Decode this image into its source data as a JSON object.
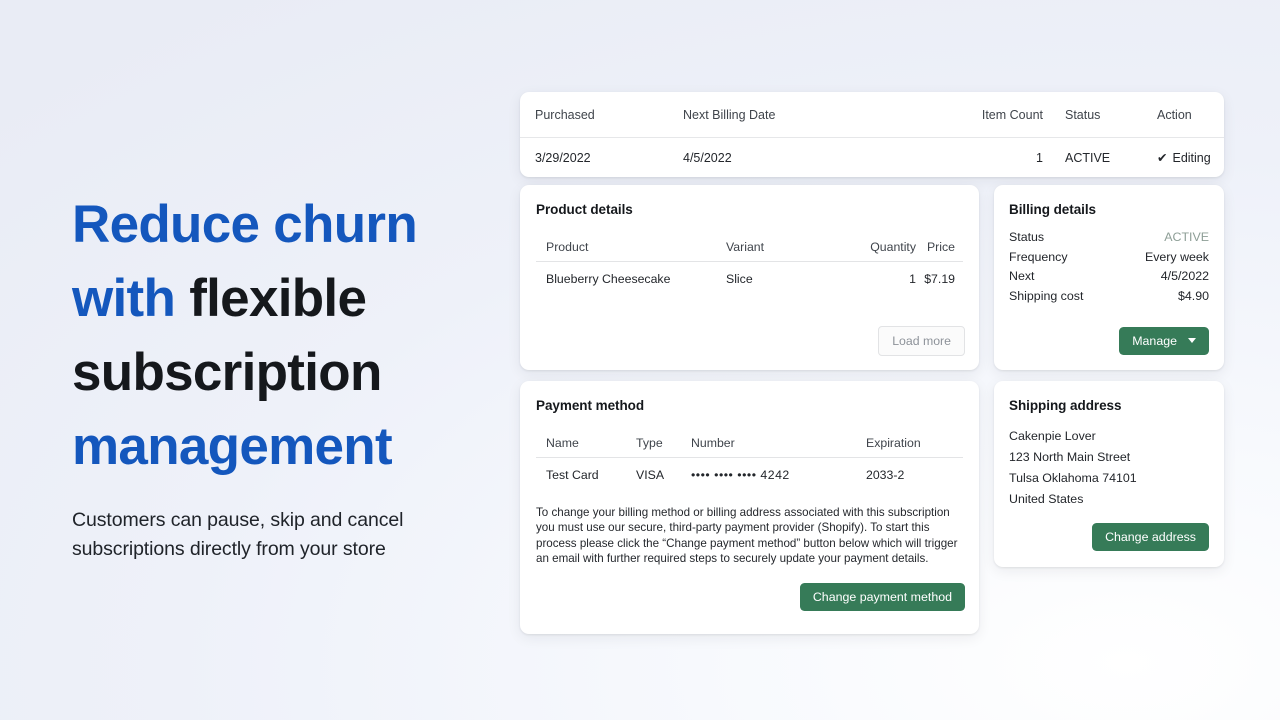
{
  "promo": {
    "headline_part1": "Reduce churn",
    "headline_part2": "with ",
    "headline_part3": "flexible",
    "headline_part4": "subscription",
    "headline_part5": "management",
    "subhead_line1": "Customers can pause, skip and cancel",
    "subhead_line2": "subscriptions directly from your store",
    "accent_blue": "#1457bd",
    "accent_dark": "#15181c"
  },
  "summary": {
    "headers": {
      "purchased": "Purchased",
      "next_billing_date": "Next Billing Date",
      "item_count": "Item Count",
      "status": "Status",
      "action": "Action"
    },
    "row": {
      "purchased": "3/29/2022",
      "next_billing_date": "4/5/2022",
      "item_count": "1",
      "status": "ACTIVE",
      "action": "Editing",
      "action_icon": "check-icon"
    }
  },
  "product_details": {
    "title": "Product details",
    "headers": {
      "product": "Product",
      "variant": "Variant",
      "quantity": "Quantity",
      "price": "Price"
    },
    "rows": [
      {
        "product": "Blueberry Cheesecake",
        "variant": "Slice",
        "quantity": "1",
        "price": "$7.19"
      }
    ],
    "load_more_label": "Load more"
  },
  "billing_details": {
    "title": "Billing details",
    "rows": [
      {
        "label": "Status",
        "value": "ACTIVE",
        "muted": true
      },
      {
        "label": "Frequency",
        "value": "Every week"
      },
      {
        "label": "Next",
        "value": "4/5/2022"
      },
      {
        "label": "Shipping cost",
        "value": "$4.90"
      }
    ],
    "manage_label": "Manage",
    "button_color": "#367b58",
    "status_color": "#8d9e96"
  },
  "payment_method": {
    "title": "Payment method",
    "headers": {
      "name": "Name",
      "type": "Type",
      "number": "Number",
      "expiration": "Expiration"
    },
    "rows": [
      {
        "name": "Test Card",
        "type": "VISA",
        "number": "•••• •••• •••• 4242",
        "expiration": "2033-2"
      }
    ],
    "legal_text": "To change your billing method or billing address associated with this subscription you must use our secure, third-party payment provider (Shopify). To start this process please click the “Change payment method” button below which will trigger an email with further required steps to securely update your payment details.",
    "change_payment_label": "Change payment method"
  },
  "shipping_address": {
    "title": "Shipping address",
    "lines": [
      "Cakenpie Lover",
      "123 North Main Street",
      "Tulsa Oklahoma 74101",
      "United States"
    ],
    "change_address_label": "Change address"
  }
}
